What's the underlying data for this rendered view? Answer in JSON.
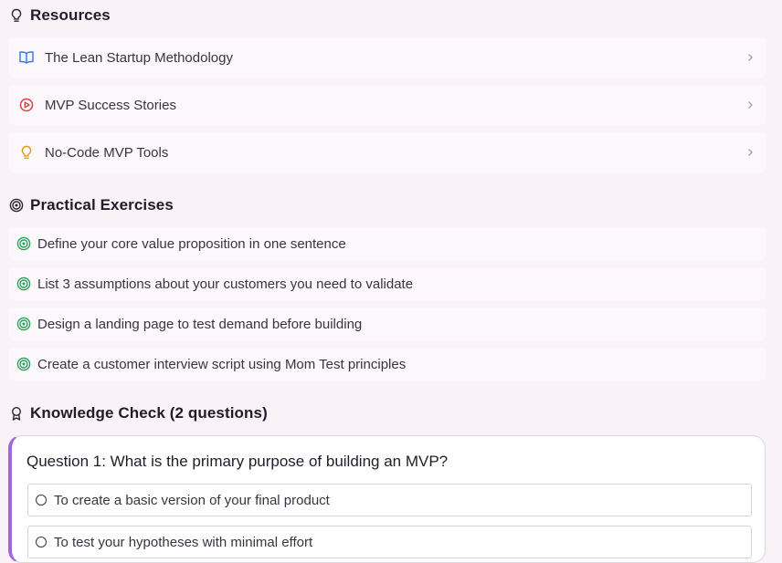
{
  "resources": {
    "heading": "Resources",
    "items": [
      {
        "label": "The Lean Startup Methodology",
        "icon": "book-open-icon",
        "color": "#3d7be0"
      },
      {
        "label": "MVP Success Stories",
        "icon": "play-circle-icon",
        "color": "#d24242"
      },
      {
        "label": "No-Code MVP Tools",
        "icon": "lightbulb-icon",
        "color": "#d9a020"
      }
    ]
  },
  "exercises": {
    "heading": "Practical Exercises",
    "items": [
      {
        "label": "Define your core value proposition in one sentence"
      },
      {
        "label": "List 3 assumptions about your customers you need to validate"
      },
      {
        "label": "Design a landing page to test demand before building"
      },
      {
        "label": "Create a customer interview script using Mom Test principles"
      }
    ],
    "icon_color": "#2e9d5a"
  },
  "knowledge": {
    "heading": "Knowledge Check (2 questions)",
    "question": "Question 1: What is the primary purpose of building an MVP?",
    "options": [
      "To create a basic version of your final product",
      "To test your hypotheses with minimal effort"
    ],
    "accent": "#a065e0"
  }
}
